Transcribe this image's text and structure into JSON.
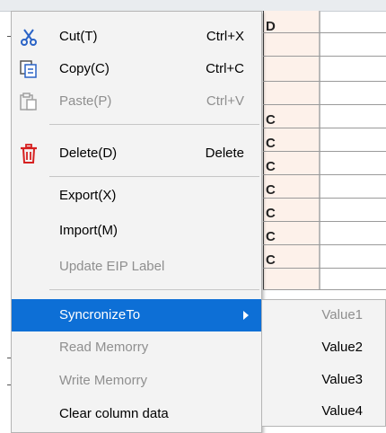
{
  "background": {
    "cell_glyphs": [
      "D",
      "C",
      "C",
      "C",
      "C",
      "C",
      "C",
      "C"
    ]
  },
  "menu": {
    "items": [
      {
        "label": "Cut(T)",
        "shortcut": "Ctrl+X",
        "icon": "scissors-icon",
        "enabled": true
      },
      {
        "label": "Copy(C)",
        "shortcut": "Ctrl+C",
        "icon": "copy-icon",
        "enabled": true
      },
      {
        "label": "Paste(P)",
        "shortcut": "Ctrl+V",
        "icon": "paste-icon",
        "enabled": false
      },
      {
        "label": "Delete(D)",
        "shortcut": "Delete",
        "icon": "trash-icon",
        "enabled": true
      },
      {
        "label": "Export(X)",
        "enabled": true
      },
      {
        "label": "Import(M)",
        "enabled": true
      },
      {
        "label": "Update EIP Label",
        "enabled": false
      },
      {
        "label": "SyncronizeTo",
        "enabled": true,
        "selected": true,
        "has_submenu": true
      },
      {
        "label": "Read Memorry",
        "enabled": false
      },
      {
        "label": "Write Memorry",
        "enabled": false
      },
      {
        "label": "Clear column data",
        "enabled": true
      }
    ]
  },
  "submenu": {
    "items": [
      {
        "label": "Value1",
        "enabled": false
      },
      {
        "label": "Value2",
        "enabled": true
      },
      {
        "label": "Value3",
        "enabled": true
      },
      {
        "label": "Value4",
        "enabled": true
      }
    ]
  },
  "colors": {
    "selection": "#0d6fd6",
    "menu_background": "#f3f3f3",
    "disabled_text": "#8f8f8f",
    "delete_icon": "#d62020",
    "cut_icon": "#2a63c6"
  }
}
